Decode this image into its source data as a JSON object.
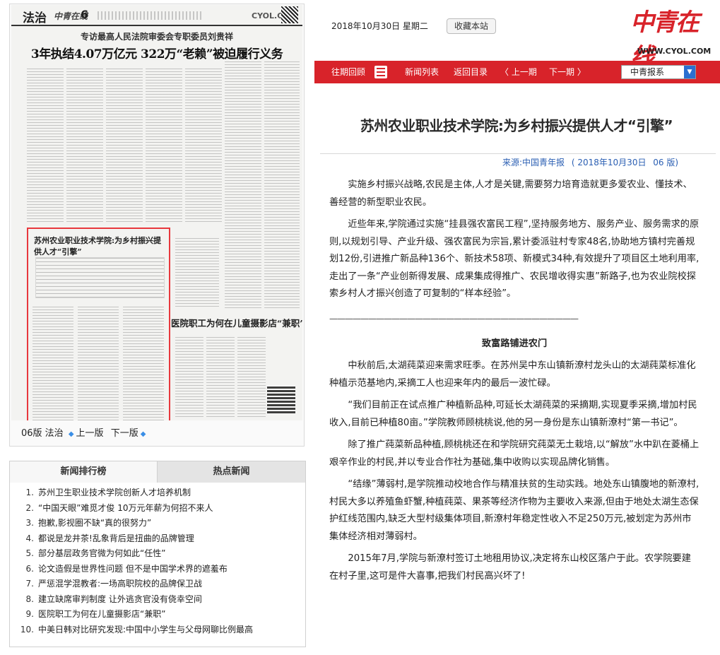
{
  "newspaper": {
    "section": "法治",
    "paper_logo": "中青在线",
    "page_number": "6",
    "brand": "CYOL.COM",
    "subheadline": "专访最高人民法院审委会专职委员刘贵祥",
    "headline": "3年执结4.07万亿元  322万“老赖”被迫履行义务",
    "highlighted_title": "苏州农业职业技术学院:为乡村振兴提供人才“引擎”",
    "second_title": "医院职工为何在儿童摄影店“兼职”"
  },
  "page_nav": {
    "current": "06版 法治",
    "prev": "上一版",
    "next": "下一版"
  },
  "ranking": {
    "tabs": [
      "新闻排行榜",
      "热点新闻"
    ],
    "items": [
      {
        "num": "1.",
        "text": "苏州卫生职业技术学院创新人才培养机制"
      },
      {
        "num": "2.",
        "text": "“中国天眼”难觅才俊 10万元年薪为何招不来人"
      },
      {
        "num": "3.",
        "text": "抱歉,影视圈不缺“真的很努力”"
      },
      {
        "num": "4.",
        "text": "都说是龙井茶!乱象背后是扭曲的品牌管理"
      },
      {
        "num": "5.",
        "text": "部分基层政务官微为何如此“任性”"
      },
      {
        "num": "6.",
        "text": "论文造假是世界性问题 但不是中国学术界的遮羞布"
      },
      {
        "num": "7.",
        "text": "严惩混学混教者:一场高职院校的品牌保卫战"
      },
      {
        "num": "8.",
        "text": "建立缺席审判制度 让外逃贪官没有侥幸空间"
      },
      {
        "num": "9.",
        "text": "医院职工为何在儿童摄影店“兼职”"
      },
      {
        "num": "10.",
        "text": "中美日韩对比研究发现:中国中小学生与父母网聊比例最高"
      }
    ]
  },
  "header": {
    "date": "2018年10月30日  星期二",
    "bookmark_button": "收藏本站",
    "logo_text": "中青在线",
    "logo_url": "WWW.CYOL.COM"
  },
  "nav": {
    "archive": "往期回顾",
    "news_list": "新闻列表",
    "back_to_index": "返回目录",
    "prev_issue": "上一期",
    "next_issue": "下一期",
    "paper_select": "中青报系",
    "accent_color": "#d8232a"
  },
  "article": {
    "title": "苏州农业职业技术学院:为乡村振兴提供人才“引擎”",
    "source_label": "来源:中国青年报",
    "date_label": "( 2018年10月30日",
    "page_label": "06 版)",
    "paragraphs": [
      "实施乡村振兴战略,农民是主体,人才是关键,需要努力培育造就更多爱农业、懂技术、善经营的新型职业农民。",
      "近些年来,学院通过实施“挂县强农富民工程”,坚持服务地方、服务产业、服务需求的原则,以规划引导、产业升级、强农富民为宗旨,累计委派驻村专家48名,协助地方镇村完善规划12份,引进推广新品种136个、新技术58项、新模式34种,有效提升了项目区土地利用率,走出了一条“产业创新得发展、成果集成得推广、农民增收得实惠”新路子,也为农业院校探索乡村人才振兴创造了可复制的“样本经验”。"
    ],
    "divider": "————————————————————————————————",
    "subtitle": "致富路铺进农门",
    "paragraphs2": [
      "中秋前后,太湖莼菜迎来需求旺季。在苏州吴中东山镇新潦村龙头山的太湖莼菜标准化种植示范基地内,采摘工人也迎来年内的最后一波忙碌。",
      "“我们目前正在试点推广种植新品种,可延长太湖莼菜的采摘期,实现夏季采摘,增加村民收入,目前已种植80亩。”学院教师顾桃桃说,他的另一身份是东山镇新潦村“第一书记”。",
      "除了推广莼菜新品种植,顾桃桃还在和学院研究莼菜无土栽培,以“解放”水中趴在菱桶上艰辛作业的村民,并以专业合作社为基础,集中收购以实现品牌化销售。",
      "“结缘”薄弱村,是学院推动校地合作与精准扶贫的生动实践。地处东山镇腹地的新潦村,村民大多以养殖鱼虾蟹,种植莼菜、果茶等经济作物为主要收入来源,但由于地处太湖生态保护红线范围内,缺乏大型村级集体项目,新潦村年稳定性收入不足250万元,被划定为苏州市集体经济相对薄弱村。",
      "2015年7月,学院与新潦村签订土地租用协议,决定将东山校区落户于此。农学院要建在村子里,这可是件大喜事,把我们村民高兴坏了!"
    ]
  }
}
